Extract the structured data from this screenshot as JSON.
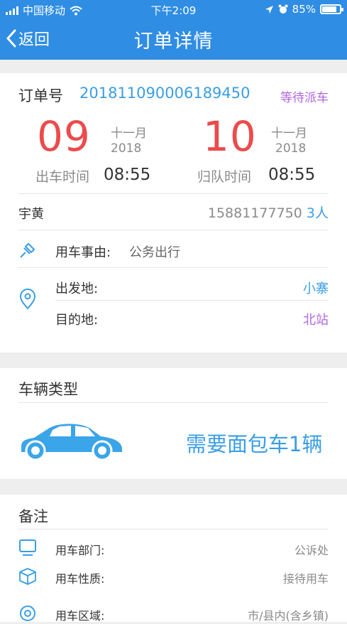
{
  "status_bar": {
    "carrier": "中国移动",
    "time": "下午2:09",
    "battery": "85%",
    "battery_level": 0.85
  },
  "nav": {
    "back_label": "返回",
    "title": "订单详情"
  },
  "order": {
    "number_label": "订单号",
    "number": "201811090006189450",
    "status": "等待派车",
    "depart": {
      "day": "09",
      "month": "十一月",
      "year": "2018",
      "label": "出车时间",
      "time": "08:55"
    },
    "return": {
      "day": "10",
      "month": "十一月",
      "year": "2018",
      "label": "归队时间",
      "time": "08:55"
    },
    "person": "宇黄",
    "phone": "15881177750",
    "people_count": "3人",
    "reason_label": "用车事由:",
    "reason": "公务出行",
    "origin_label": "出发地:",
    "origin": "小寨",
    "destination_label": "目的地:",
    "destination": "北站"
  },
  "vehicle": {
    "section_title": "车辆类型",
    "request": "需要面包车1辆"
  },
  "remarks": {
    "section_title": "备注",
    "items": [
      {
        "label": "用车部门:",
        "value": "公诉处",
        "icon": "monitor-icon"
      },
      {
        "label": "用车性质:",
        "value": "接待用车",
        "icon": "box-icon"
      },
      {
        "label": "用车区域:",
        "value": "市/县内(含乡镇)",
        "icon": "area-icon"
      }
    ]
  },
  "colors": {
    "header": "#2f8de4",
    "accent_red": "#ec4b4b",
    "accent_blue": "#3a9ee6",
    "accent_purple": "#b266e0"
  }
}
